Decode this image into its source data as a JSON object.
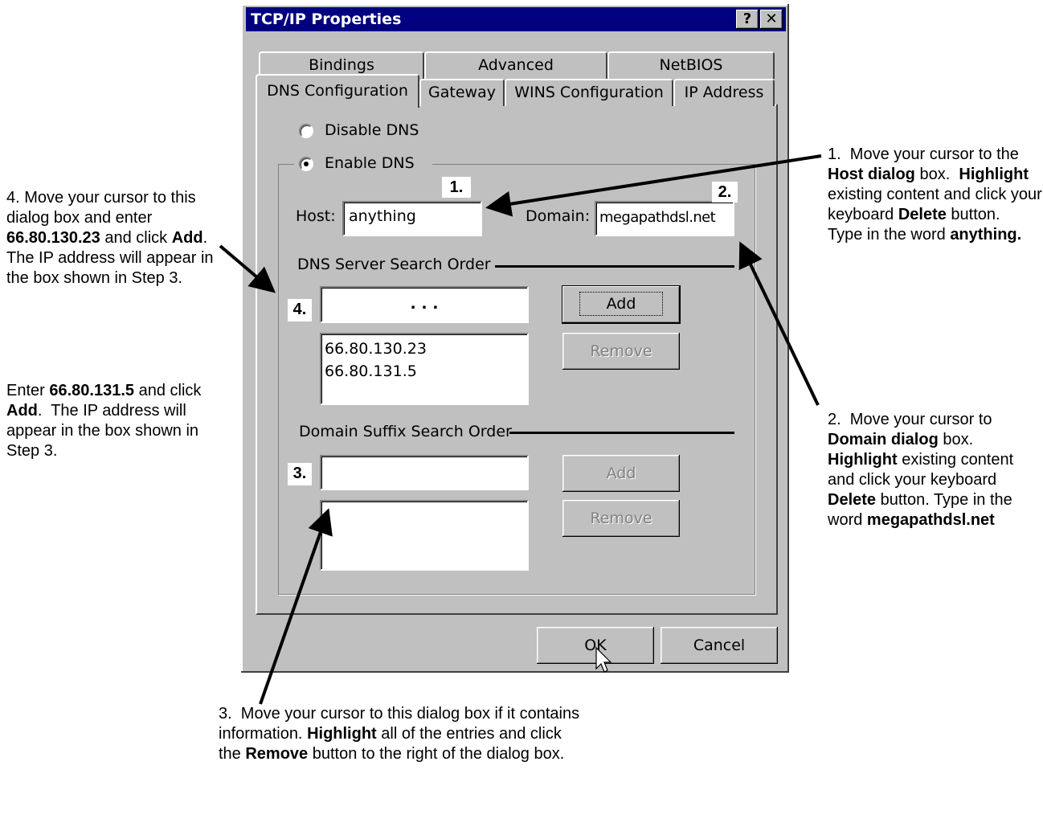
{
  "window": {
    "title": "TCP/IP Properties",
    "help_btn": "?",
    "close_btn": "✕",
    "tabs_back": [
      "Bindings",
      "Advanced",
      "NetBIOS"
    ],
    "tabs_front": [
      "DNS Configuration",
      "Gateway",
      "WINS Configuration",
      "IP Address"
    ],
    "active_tab": "DNS Configuration"
  },
  "dns": {
    "disable_label": "Disable DNS",
    "enable_label": "Enable DNS",
    "selected": "Enable DNS",
    "host_label": "Host:",
    "host_value": "anything",
    "domain_label": "Domain:",
    "domain_value": "megapathdsl.net",
    "server_group": "DNS Server Search Order",
    "ip_placeholder": ".     .     .",
    "add_btn": "Add",
    "remove_btn": "Remove",
    "server_list": [
      "66.80.130.23",
      "66.80.131.5"
    ],
    "suffix_group": "Domain Suffix Search Order",
    "suffix_add_btn": "Add",
    "suffix_remove_btn": "Remove"
  },
  "footer": {
    "ok": "OK",
    "cancel": "Cancel"
  },
  "markers": [
    "1.",
    "2.",
    "3.",
    "4."
  ],
  "annotations": {
    "note1": "1.  Move your cursor to the Host dialog box.  Highlight existing content and click your keyboard Delete button.  Type in the word anything.",
    "note2": "2.  Move your cursor to Domain dialog box. Highlight existing content and click your keyboard Delete button. Type in the word megapathdsl.net",
    "note3": "3.  Move your cursor to this dialog box if it contains information. Highlight all of the entries and click the Remove button to the right of the dialog box.",
    "note4a": "4. Move your cursor to this dialog box and enter 66.80.130.23 and click Add.  The IP address will appear in the box shown in Step 3.",
    "note4b": "Enter 66.80.131.5 and click Add.  The IP address will appear in the box shown in Step 3."
  }
}
